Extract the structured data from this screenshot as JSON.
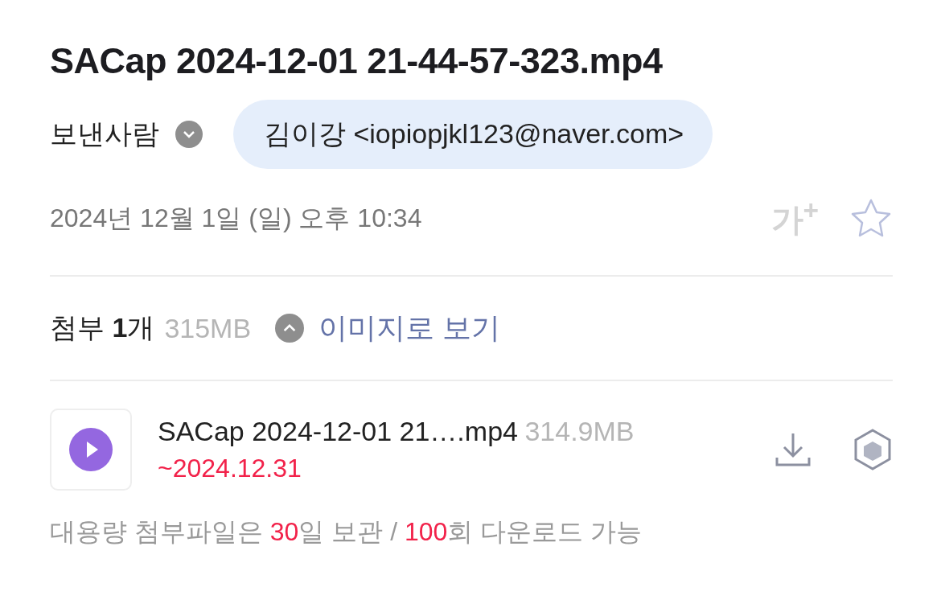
{
  "subject": "SACap 2024-12-01 21-44-57-323.mp4",
  "sender": {
    "label": "보낸사람",
    "address": "김이강 <iopiopjkl123@naver.com>"
  },
  "date": "2024년 12월 1일 (일) 오후 10:34",
  "font_size_button": "가$^{+}$",
  "starred": false,
  "attachments_header": {
    "count": "첨부 **1**개",
    "size": "315MB",
    "expanded": true,
    "view_as_image": "이미지로 보기"
  },
  "attachments": [
    {
      "name": "SACap 2024-12-01 21….mp4",
      "size": "314.9MB",
      "expiry": "~2024.12.31"
    }
  ],
  "note": [
    {
      "text": "대용량 첨부파일은 ",
      "highlight": false
    },
    {
      "text": "30",
      "highlight": true
    },
    {
      "text": "일 보관 / ",
      "highlight": false
    },
    {
      "text": "100",
      "highlight": true
    },
    {
      "text": "회 다운로드 가능",
      "highlight": false
    }
  ]
}
